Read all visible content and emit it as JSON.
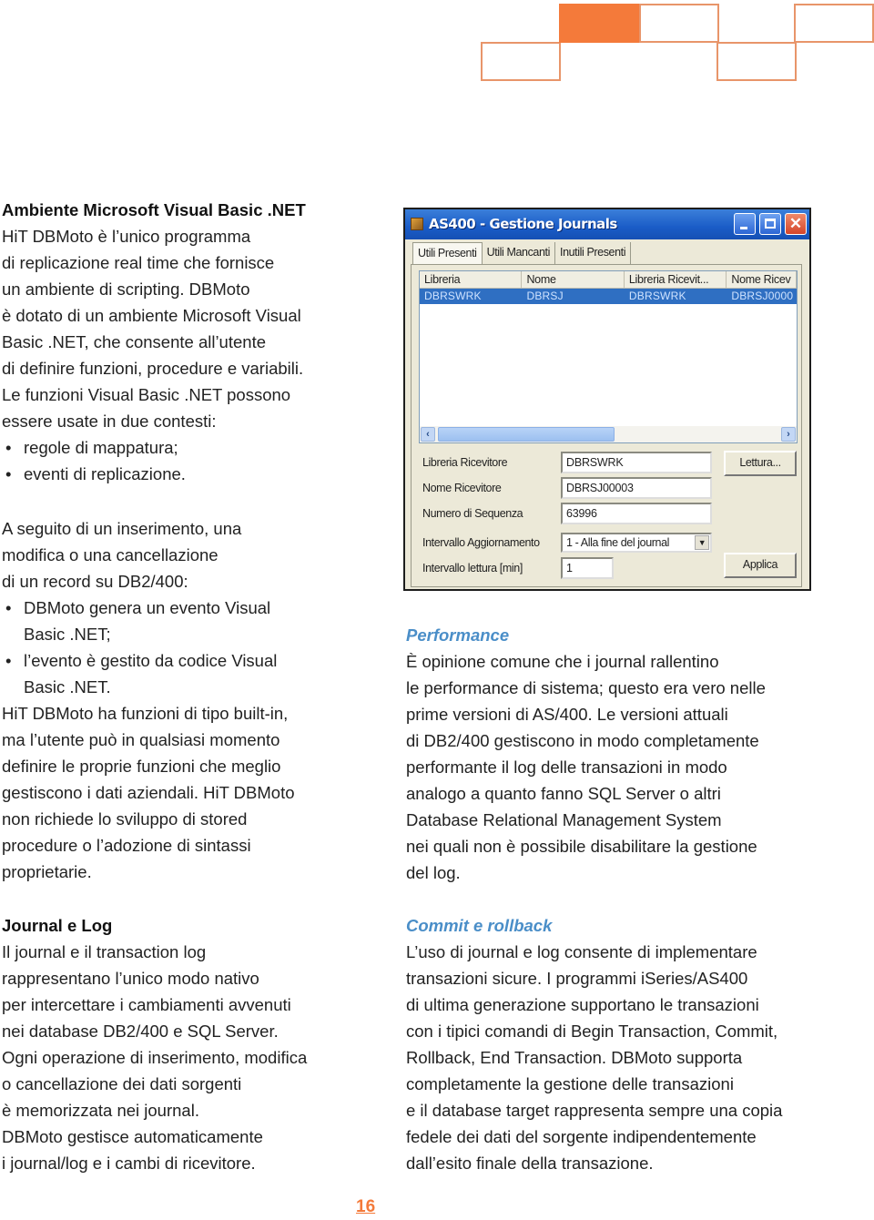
{
  "colors": {
    "accent_orange": "#f47a3a",
    "heading_blue": "#4a8ec8",
    "selection_blue": "#2f6fc2"
  },
  "left_column": {
    "section1": {
      "heading": "Ambiente Microsoft Visual Basic .NET",
      "lines": [
        "HiT DBMoto è l’unico programma",
        "di replicazione real time che fornisce",
        "un ambiente di scripting. DBMoto",
        "è dotato di un ambiente Microsoft Visual",
        "Basic .NET, che consente all’utente",
        "di definire funzioni, procedure e variabili.",
        "Le funzioni Visual Basic .NET possono",
        "essere usate in due contesti:"
      ],
      "bullets": [
        "regole di mappatura;",
        "eventi di replicazione."
      ]
    },
    "section2": {
      "lines": [
        "A seguito di un inserimento, una",
        "modifica o una cancellazione",
        "di un record su DB2/400:"
      ],
      "bullets": [
        {
          "line1": "DBMoto genera un evento Visual",
          "line2": "Basic .NET;"
        },
        {
          "line1": "l’evento è gestito da codice Visual",
          "line2": "Basic .NET."
        }
      ],
      "after_lines": [
        "HiT DBMoto ha funzioni di tipo built-in,",
        "ma l’utente può in qualsiasi momento",
        "definire le proprie funzioni che meglio",
        "gestiscono i dati aziendali. HiT DBMoto",
        "non richiede lo sviluppo di stored",
        "procedure o l’adozione di sintassi",
        "proprietarie."
      ]
    },
    "section3": {
      "heading": "Journal e Log",
      "lines": [
        "Il journal e il transaction log",
        "rappresentano l’unico modo nativo",
        "per intercettare i cambiamenti avvenuti",
        "nei database DB2/400 e SQL Server.",
        "Ogni operazione di inserimento, modifica",
        "o cancellazione dei dati sorgenti",
        "è memorizzata nei journal.",
        "DBMoto gestisce automaticamente",
        "i journal/log e i cambi di ricevitore."
      ]
    }
  },
  "right_column": {
    "performance": {
      "heading": "Performance",
      "lines": [
        "È opinione comune che i journal rallentino",
        "le performance di sistema; questo era vero nelle",
        "prime versioni di AS/400. Le versioni attuali",
        "di DB2/400 gestiscono in modo completamente",
        "performante il log delle transazioni in modo",
        "analogo a quanto fanno SQL Server o altri",
        "Database Relational Management System",
        "nei quali non è possibile disabilitare la gestione",
        "del log."
      ]
    },
    "commit": {
      "heading": "Commit e rollback",
      "lines": [
        "L’uso di journal e log consente di implementare",
        "transazioni sicure. I programmi iSeries/AS400",
        "di ultima generazione supportano le transazioni",
        "con i tipici comandi di Begin Transaction, Commit,",
        "Rollback, End Transaction. DBMoto supporta",
        "completamente la gestione delle transazioni",
        "e il database target rappresenta sempre una copia",
        "fedele dei dati del sorgente indipendentemente",
        "dall’esito finale della transazione."
      ]
    }
  },
  "window": {
    "title": "AS400 - Gestione Journals",
    "controls": {
      "minimize": "_",
      "maximize": "□",
      "close": "✕"
    },
    "tabs": [
      "Utili Presenti",
      "Utili Mancanti",
      "Inutili Presenti"
    ],
    "active_tab": 0,
    "list": {
      "columns": [
        "Libreria",
        "Nome",
        "Libreria Ricevit...",
        "Nome Ricev"
      ],
      "rows": [
        [
          "DBRSWRK",
          "DBRSJ",
          "DBRSWRK",
          "DBRSJ0000"
        ]
      ]
    },
    "scroll": {
      "left_arrow": "‹",
      "right_arrow": "›"
    },
    "form": {
      "libreria_ricevitore": {
        "label": "Libreria Ricevitore",
        "value": "DBRSWRK"
      },
      "nome_ricevitore": {
        "label": "Nome Ricevitore",
        "value": "DBRSJ00003"
      },
      "numero_sequenza": {
        "label": "Numero di Sequenza",
        "value": "63996"
      },
      "intervallo_aggiornamento": {
        "label": "Intervallo Aggiornamento",
        "value": "1 - Alla fine del journal",
        "arrow": "▼"
      },
      "intervallo_lettura": {
        "label": "Intervallo lettura [min]",
        "value": "1"
      },
      "lettura_button": "Lettura...",
      "applica_button": "Applica"
    }
  },
  "page_number": "16"
}
